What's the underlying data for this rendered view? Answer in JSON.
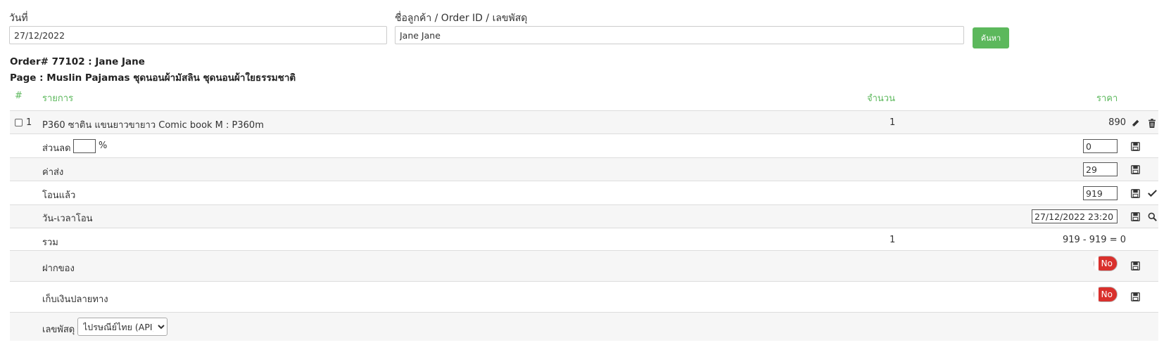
{
  "search": {
    "date_label": "วันที่",
    "date_value": "27/12/2022",
    "query_label": "ชื่อลูกค้า / Order ID / เลขพัสดุ",
    "query_value": "Jane Jane",
    "button_label": "ค้นหา"
  },
  "order": {
    "title": "Order# 77102 : Jane Jane",
    "page": "Page : Muslin Pajamas ชุดนอนผ้ามัสลิน ชุดนอนผ้าใยธรรมชาติ"
  },
  "table": {
    "headers": {
      "num": "#",
      "item": "รายการ",
      "qty": "จำนวน",
      "price": "ราคา"
    },
    "item": {
      "index": "1",
      "name": "P360 ซาติน แขนยาวขายาว Comic book M : P360m",
      "qty": "1",
      "price": "890"
    },
    "discount": {
      "label": "ส่วนลด",
      "percent_value": "",
      "percent_sign": "%",
      "value": "0"
    },
    "shipping": {
      "label": "ค่าส่ง",
      "value": "29"
    },
    "transferred": {
      "label": "โอนแล้ว",
      "value": "919"
    },
    "transfer_datetime": {
      "label": "วัน-เวลาโอน",
      "value": "27/12/2022 23:20"
    },
    "total": {
      "label": "รวม",
      "qty": "1",
      "value": "919 - 919 = 0"
    },
    "deposit": {
      "label": "ฝากของ",
      "toggle": "No"
    },
    "cod": {
      "label": "เก็บเงินปลายทาง",
      "toggle": "No"
    },
    "tracking": {
      "label": "เลขพัสดุ",
      "carrier_selected": "ไปรษณีย์ไทย (API)"
    }
  },
  "colors": {
    "accent_green": "#5cb85c",
    "toggle_red": "#d9302c"
  },
  "icons": [
    "pencil-icon",
    "trash-icon",
    "save-icon",
    "check-icon",
    "search-icon",
    "chevron-down-icon"
  ]
}
